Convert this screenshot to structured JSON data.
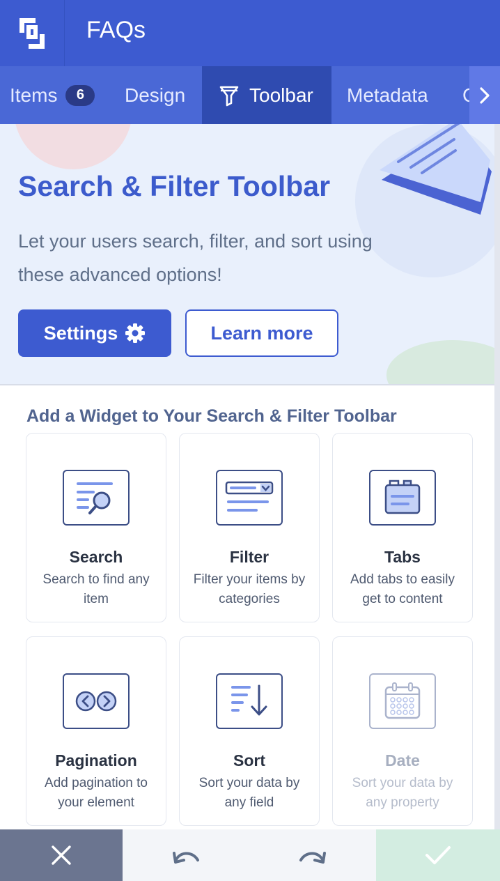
{
  "header": {
    "title": "FAQs",
    "logo_icon": "app-logo-icon"
  },
  "tabs": [
    {
      "label": "Items",
      "badge": "6"
    },
    {
      "label": "Design"
    },
    {
      "label": "Toolbar",
      "icon": "filter-icon",
      "active": true
    },
    {
      "label": "Metadata"
    },
    {
      "label": "C"
    }
  ],
  "hero": {
    "title": "Search & Filter Toolbar",
    "description": "Let your users search, filter, and sort using these advanced options!",
    "settings_label": "Settings",
    "learn_more_label": "Learn more"
  },
  "widgets": {
    "section_title": "Add a Widget to Your Search & Filter Toolbar",
    "items": [
      {
        "title": "Search",
        "desc": "Search to find any item",
        "icon": "search-widget-icon"
      },
      {
        "title": "Filter",
        "desc": "Filter your items by categories",
        "icon": "filter-widget-icon"
      },
      {
        "title": "Tabs",
        "desc": "Add tabs to easily get to content",
        "icon": "tabs-widget-icon"
      },
      {
        "title": "Pagination",
        "desc": "Add pagination to your element",
        "icon": "pagination-widget-icon"
      },
      {
        "title": "Sort",
        "desc": "Sort your data by any field",
        "icon": "sort-widget-icon"
      },
      {
        "title": "Date",
        "desc": "Sort your data by any property",
        "icon": "calendar-widget-icon",
        "disabled": true
      }
    ]
  },
  "footer": {
    "cancel_icon": "close-icon",
    "undo_icon": "undo-icon",
    "redo_icon": "redo-icon",
    "confirm_icon": "check-icon"
  },
  "colors": {
    "primary": "#3d5bd0",
    "tab_bar": "#4a68d6",
    "active_tab": "#2f4bb0",
    "hero_bg": "#e9f0fc",
    "confirm_bg": "#d3ede1",
    "cancel_bg": "#6b7590"
  }
}
